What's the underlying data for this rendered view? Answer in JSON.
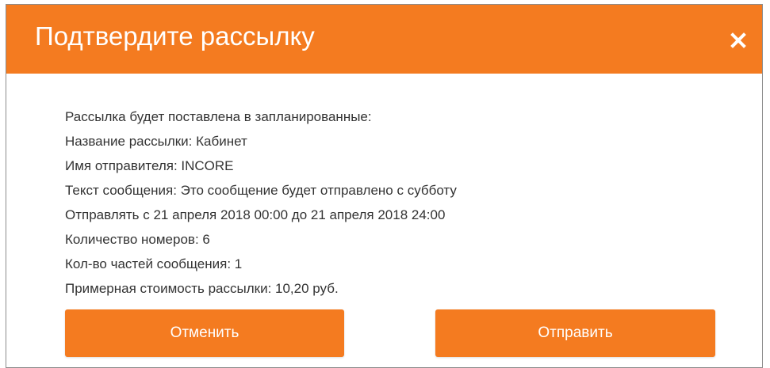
{
  "modal": {
    "title": "Подтвердите рассылку",
    "close_icon": "close-icon",
    "accent_color": "#f47b20",
    "text_color": "#333333"
  },
  "details": {
    "lines": [
      "Рассылка будет поставлена в запланированные:",
      "Название рассылки: Кабинет",
      "Имя отправителя: INCORE",
      "Текст сообщения: Это сообщение будет отправлено с субботу",
      "Отправлять с 21 апреля 2018 00:00 до 21 апреля 2018 24:00",
      "Количество номеров: 6",
      "Кол-во частей сообщения: 1",
      "Примерная стоимость рассылки: 10,20 руб."
    ]
  },
  "actions": {
    "cancel_label": "Отменить",
    "send_label": "Отправить"
  }
}
